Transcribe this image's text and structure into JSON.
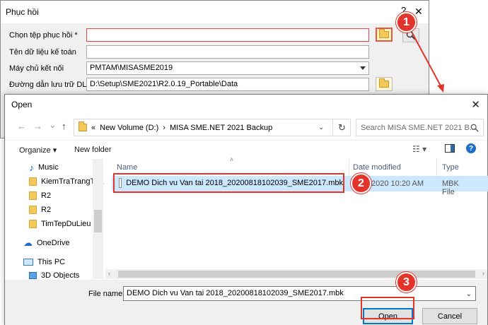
{
  "restore_dialog": {
    "title": "Phục hồi",
    "help_glyph": "?",
    "close_glyph": "✕",
    "rows": [
      {
        "label": "Chọn tệp phục hồi *",
        "value": ""
      },
      {
        "label": "Tên dữ liệu kế toán",
        "value": ""
      },
      {
        "label": "Máy chủ kết nối",
        "value": "PMTAM\\MISASME2019"
      },
      {
        "label": "Đường dẫn lưu trữ DLKT",
        "value": "D:\\Setup\\SME2021\\R2.0.19_Portable\\Data"
      }
    ]
  },
  "callouts": [
    "1",
    "2",
    "3"
  ],
  "open_dialog": {
    "title": "Open",
    "close_glyph": "✕",
    "nav": {
      "back": "←",
      "forward": "→",
      "history": "⌄",
      "up": "↑"
    },
    "breadcrumb": [
      "«",
      "New Volume (D:)",
      "›",
      "MISA SME.NET 2021 Backup"
    ],
    "refresh_glyph": "↻",
    "search_placeholder": "Search MISA SME.NET 2021 B...",
    "toolbar": {
      "organize": "Organize ▾",
      "new_folder": "New folder",
      "help": "?"
    },
    "nav_items": [
      "Music",
      "KiemTraTrangThai",
      "R2",
      "R2",
      "TimTepDuLieu",
      "OneDrive",
      "This PC",
      "3D Objects"
    ],
    "columns": {
      "name": "Name",
      "date": "Date modified",
      "type": "Type"
    },
    "files": [
      {
        "name": "DEMO Dich vu Van tai 2018_20200818102039_SME2017.mbk",
        "date": "2020 10:20 AM",
        "type": "MBK File"
      }
    ],
    "file_name_label": "File name:",
    "file_name_value": "DEMO Dich vu Van tai 2018_20200818102039_SME2017.mbk",
    "open_label": "Open",
    "cancel_label": "Cancel"
  },
  "colors": {
    "callout": "#e2342a",
    "selection": "#cce8ff",
    "accent": "#0078d7"
  }
}
